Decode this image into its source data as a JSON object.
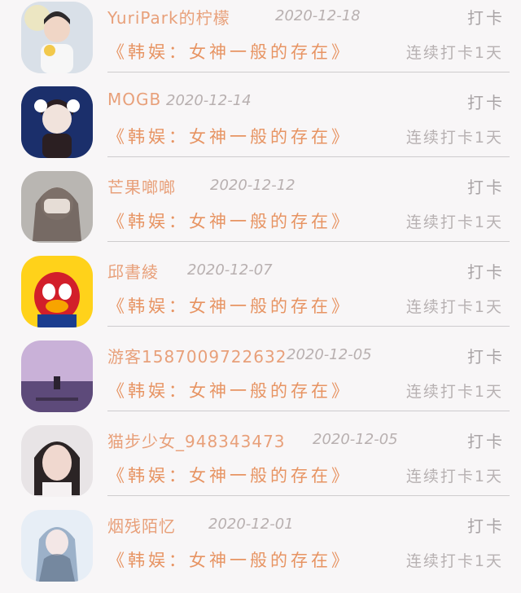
{
  "checkin_label": "打卡",
  "topic_label": "《韩娱：女神一般的存在》",
  "streak_label": "连续打卡1天",
  "items": [
    {
      "name": "YuriPark的柠檬",
      "date": "2020-12-18",
      "avatar_colors": [
        "#dfe4ea",
        "#8aa0b8",
        "#2d2a2c"
      ]
    },
    {
      "name": "MOGB",
      "date": "2020-12-14",
      "avatar_colors": [
        "#1b2f6b",
        "#f1e3dc",
        "#2b1f22"
      ]
    },
    {
      "name": "芒果啷啷",
      "date": "2020-12-12",
      "avatar_colors": [
        "#b9b6b2",
        "#6a5d56",
        "#e6ddd6"
      ]
    },
    {
      "name": "邱書綾",
      "date": "2020-12-07",
      "avatar_colors": [
        "#ffd21a",
        "#d21f2a",
        "#1b3d8f"
      ]
    },
    {
      "name": "游客1587009722632",
      "date": "2020-12-05",
      "avatar_colors": [
        "#c9b1d8",
        "#5d4a7a",
        "#2a2230"
      ]
    },
    {
      "name": "猫步少女_948343473",
      "date": "2020-12-05",
      "avatar_colors": [
        "#e8e4e6",
        "#2b2425",
        "#f0d8cf"
      ]
    },
    {
      "name": "烟残陌忆",
      "date": "2020-12-01",
      "avatar_colors": [
        "#e7eef6",
        "#9cb1c9",
        "#5b6c84"
      ]
    }
  ]
}
